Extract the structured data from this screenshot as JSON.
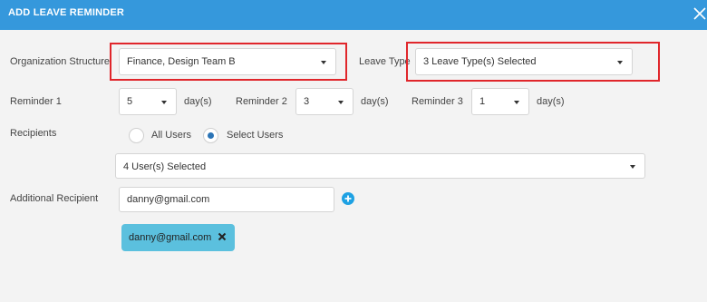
{
  "dialog": {
    "title": "ADD LEAVE REMINDER",
    "close_icon": "close-icon"
  },
  "org_structure": {
    "label": "Organization Structure",
    "value": "Finance, Design Team B"
  },
  "leave_type": {
    "label": "Leave Type",
    "value": "3 Leave Type(s) Selected"
  },
  "reminders": [
    {
      "label": "Reminder 1",
      "value": "5",
      "unit": "day(s)"
    },
    {
      "label": "Reminder 2",
      "value": "3",
      "unit": "day(s)"
    },
    {
      "label": "Reminder 3",
      "value": "1",
      "unit": "day(s)"
    }
  ],
  "recipients": {
    "label": "Recipients",
    "options": [
      "All Users",
      "Select Users"
    ],
    "selected": "Select Users",
    "users_selected": "4 User(s) Selected"
  },
  "additional_recipient": {
    "label": "Additional Recipient",
    "value": "danny@gmail.com",
    "add_icon": "plus-circle-icon",
    "tags": [
      "danny@gmail.com"
    ],
    "tag_remove_icon": "close-icon"
  },
  "colors": {
    "header": "#3598dc",
    "highlight": "#e0262b",
    "tag": "#5bc0de",
    "radio_checked": "#2b74b6"
  }
}
